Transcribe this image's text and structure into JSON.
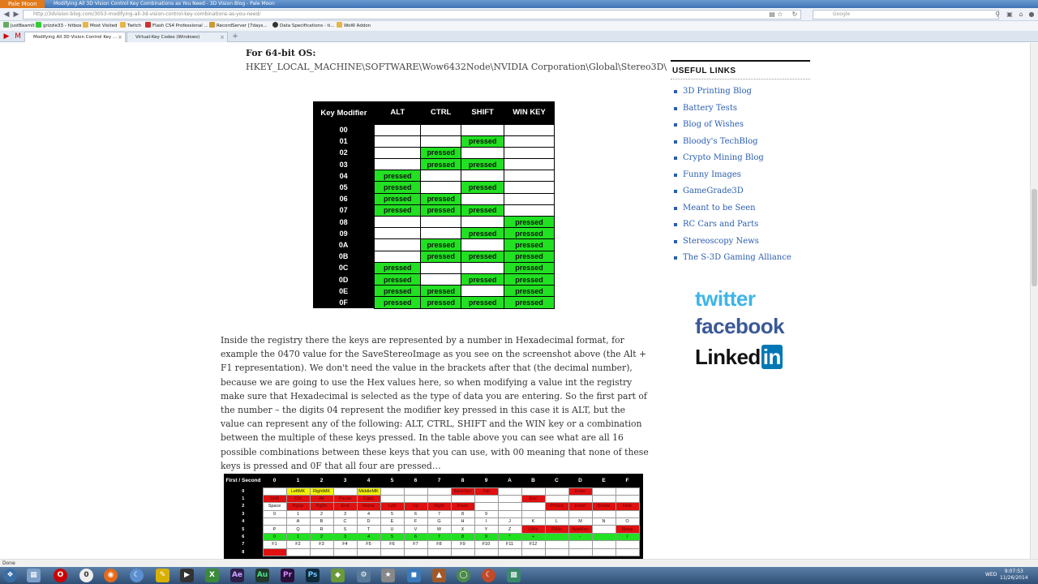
{
  "browser": {
    "app_menu": "Pale Moon",
    "window_title": "Modifying All 3D Vision Control Key Combinations as You Need - 3D Vision Blog - Pale Moon",
    "url": "http://3dvision-blog.com/3053-modifying-all-3d-vision-control-key-combinations-as-you-need/",
    "search_placeholder": "Google",
    "bookmarks": [
      "JustBeamIt",
      "grizzle33 - hitbox",
      "Most Visited",
      "Twitch",
      "Flash CS4 Professional ...",
      "RecordServer [7days...",
      "Data Specifications - ti...",
      "WoW Addon"
    ],
    "tabs": [
      {
        "label": "Modifying All 3D Vision Control Key ...",
        "active": true
      },
      {
        "label": "Virtual-Key Codes (Windows)",
        "active": false
      }
    ],
    "status": "Done"
  },
  "article": {
    "os_label": "For 64-bit OS:",
    "reg_path": "HKEY_LOCAL_MACHINE\\SOFTWARE\\Wow6432Node\\NVIDIA Corporation\\Global\\Stereo3D\\",
    "explanation": "Inside the registry there the keys are represented by a number in Hexadecimal format, for example the 0470 value for the SaveStereoImage as you see on the screenshot above (the Alt + F1 representation). We don't need the value in the brackets after that (the decimal number), because we are going to use the Hex values here, so when modifying a value int the registry make sure that Hexadecimal is selected as the type of data you are entering. So the first part of the number – the digits 04 represent the modifier key pressed in this case it is ALT, but the value can represent any of the following: ALT, CTRL, SHIFT and the WIN key or a combination between the multiple of these keys pressed. In the table above you can see what are all 16 possible combinations between these keys that you can use, with 00 meaning that none of these keys is pressed and 0F that all four are pressed…"
  },
  "modifier_table": {
    "headers": [
      "Key Modifier",
      "ALT",
      "CTRL",
      "SHIFT",
      "WIN KEY"
    ],
    "pressed_label": "pressed",
    "rows": [
      {
        "code": "00",
        "cells": [
          false,
          false,
          false,
          false
        ]
      },
      {
        "code": "01",
        "cells": [
          false,
          false,
          true,
          false
        ]
      },
      {
        "code": "02",
        "cells": [
          false,
          true,
          false,
          false
        ]
      },
      {
        "code": "03",
        "cells": [
          false,
          true,
          true,
          false
        ]
      },
      {
        "code": "04",
        "cells": [
          true,
          false,
          false,
          false
        ]
      },
      {
        "code": "05",
        "cells": [
          true,
          false,
          true,
          false
        ]
      },
      {
        "code": "06",
        "cells": [
          true,
          true,
          false,
          false
        ]
      },
      {
        "code": "07",
        "cells": [
          true,
          true,
          true,
          false
        ]
      },
      {
        "code": "08",
        "cells": [
          false,
          false,
          false,
          true
        ]
      },
      {
        "code": "09",
        "cells": [
          false,
          false,
          true,
          true
        ]
      },
      {
        "code": "0A",
        "cells": [
          false,
          true,
          false,
          true
        ]
      },
      {
        "code": "0B",
        "cells": [
          false,
          true,
          true,
          true
        ]
      },
      {
        "code": "0C",
        "cells": [
          true,
          false,
          false,
          true
        ]
      },
      {
        "code": "0D",
        "cells": [
          true,
          false,
          true,
          true
        ]
      },
      {
        "code": "0E",
        "cells": [
          true,
          true,
          false,
          true
        ]
      },
      {
        "code": "0F",
        "cells": [
          true,
          true,
          true,
          true
        ]
      }
    ]
  },
  "key_table": {
    "headers": [
      "First / Second",
      "0",
      "1",
      "2",
      "3",
      "4",
      "5",
      "6",
      "7",
      "8",
      "9",
      "A",
      "B",
      "C",
      "D",
      "E",
      "F"
    ],
    "rows": [
      {
        "label": "0",
        "cells": [
          [
            "",
            ""
          ],
          [
            "LeftMK",
            "yellow"
          ],
          [
            "RightMK",
            "yellow"
          ],
          [
            "",
            ""
          ],
          [
            "MiddleMK",
            "yellow"
          ],
          [
            "",
            ""
          ],
          [
            "",
            ""
          ],
          [
            "",
            ""
          ],
          [
            "BackSpc",
            "red"
          ],
          [
            "Tab",
            "red"
          ],
          [
            "",
            ""
          ],
          [
            "",
            ""
          ],
          [
            "",
            ""
          ],
          [
            "Enter",
            "red"
          ],
          [
            "",
            ""
          ],
          [
            "",
            ""
          ]
        ]
      },
      {
        "label": "1",
        "cells": [
          [
            "Shift",
            "red"
          ],
          [
            "Ctrl",
            "red"
          ],
          [
            "Alt",
            "red"
          ],
          [
            "Pause",
            "red"
          ],
          [
            "Caps",
            "red"
          ],
          [
            "",
            ""
          ],
          [
            "",
            ""
          ],
          [
            "",
            ""
          ],
          [
            "",
            ""
          ],
          [
            "",
            ""
          ],
          [
            "",
            ""
          ],
          [
            "Esc",
            "red"
          ],
          [
            "",
            ""
          ],
          [
            "",
            ""
          ],
          [
            "",
            ""
          ],
          [
            "",
            ""
          ]
        ]
      },
      {
        "label": "2",
        "cells": [
          [
            "Space",
            "white"
          ],
          [
            "PgUp",
            "red"
          ],
          [
            "PgDn",
            "red"
          ],
          [
            "End",
            "red"
          ],
          [
            "Home",
            "red"
          ],
          [
            "Left",
            "red"
          ],
          [
            "Up",
            "red"
          ],
          [
            "Right",
            "red"
          ],
          [
            "Down",
            "red"
          ],
          [
            "",
            ""
          ],
          [
            "",
            ""
          ],
          [
            "",
            ""
          ],
          [
            "PrtScn",
            "red"
          ],
          [
            "Insert",
            "red"
          ],
          [
            "Delete",
            "red"
          ],
          [
            "Help",
            "red"
          ]
        ]
      },
      {
        "label": "3",
        "cells": [
          [
            "0",
            ""
          ],
          [
            "1",
            ""
          ],
          [
            "2",
            ""
          ],
          [
            "3",
            ""
          ],
          [
            "4",
            ""
          ],
          [
            "5",
            ""
          ],
          [
            "6",
            ""
          ],
          [
            "7",
            ""
          ],
          [
            "8",
            ""
          ],
          [
            "9",
            ""
          ],
          [
            "",
            ""
          ],
          [
            "",
            ""
          ],
          [
            "",
            ""
          ],
          [
            "",
            ""
          ],
          [
            "",
            ""
          ],
          [
            "",
            ""
          ]
        ]
      },
      {
        "label": "4",
        "cells": [
          [
            "",
            ""
          ],
          [
            "A",
            ""
          ],
          [
            "B",
            ""
          ],
          [
            "C",
            ""
          ],
          [
            "D",
            ""
          ],
          [
            "E",
            ""
          ],
          [
            "F",
            ""
          ],
          [
            "G",
            ""
          ],
          [
            "H",
            ""
          ],
          [
            "I",
            ""
          ],
          [
            "J",
            ""
          ],
          [
            "K",
            ""
          ],
          [
            "L",
            ""
          ],
          [
            "M",
            ""
          ],
          [
            "N",
            ""
          ],
          [
            "O",
            ""
          ]
        ]
      },
      {
        "label": "5",
        "cells": [
          [
            "P",
            ""
          ],
          [
            "Q",
            ""
          ],
          [
            "R",
            ""
          ],
          [
            "S",
            ""
          ],
          [
            "T",
            ""
          ],
          [
            "U",
            ""
          ],
          [
            "V",
            ""
          ],
          [
            "W",
            ""
          ],
          [
            "X",
            ""
          ],
          [
            "Y",
            ""
          ],
          [
            "Z",
            ""
          ],
          [
            "LWin",
            "red"
          ],
          [
            "RWin",
            "red"
          ],
          [
            "AppMnu",
            "red"
          ],
          [
            "",
            ""
          ],
          [
            "Sleep",
            "red"
          ]
        ]
      },
      {
        "label": "6",
        "cells": [
          [
            "0",
            "green"
          ],
          [
            "1",
            "green"
          ],
          [
            "2",
            "green"
          ],
          [
            "3",
            "green"
          ],
          [
            "4",
            "green"
          ],
          [
            "5",
            "green"
          ],
          [
            "6",
            "green"
          ],
          [
            "7",
            "green"
          ],
          [
            "8",
            "green"
          ],
          [
            "9",
            "green"
          ],
          [
            "*",
            "green"
          ],
          [
            "+",
            "green"
          ],
          [
            "",
            "green"
          ],
          [
            "-",
            "green"
          ],
          [
            "",
            "green"
          ],
          [
            "/",
            "green"
          ]
        ]
      },
      {
        "label": "7",
        "cells": [
          [
            "F1",
            ""
          ],
          [
            "F2",
            ""
          ],
          [
            "F3",
            ""
          ],
          [
            "F4",
            ""
          ],
          [
            "F5",
            ""
          ],
          [
            "F6",
            ""
          ],
          [
            "F7",
            ""
          ],
          [
            "F8",
            ""
          ],
          [
            "F9",
            ""
          ],
          [
            "F10",
            ""
          ],
          [
            "F11",
            ""
          ],
          [
            "F12",
            ""
          ],
          [
            "",
            ""
          ],
          [
            "",
            ""
          ],
          [
            "",
            ""
          ],
          [
            "",
            ""
          ]
        ]
      },
      {
        "label": "8",
        "cells": [
          [
            "",
            "red"
          ],
          [
            "",
            ""
          ],
          [
            "",
            ""
          ],
          [
            "",
            ""
          ],
          [
            "",
            ""
          ],
          [
            "",
            ""
          ],
          [
            "",
            ""
          ],
          [
            "",
            ""
          ],
          [
            "",
            ""
          ],
          [
            "",
            ""
          ],
          [
            "",
            ""
          ],
          [
            "",
            ""
          ],
          [
            "",
            ""
          ],
          [
            "",
            ""
          ],
          [
            "",
            ""
          ],
          [
            "",
            ""
          ]
        ]
      }
    ]
  },
  "sidebar": {
    "title": "USEFUL LINKS",
    "links": [
      "3D Printing Blog",
      "Battery Tests",
      "Blog of Wishes",
      "Bloody's TechBlog",
      "Crypto Mining Blog",
      "Funny Images",
      "GameGrade3D",
      "Meant to be Seen",
      "RC Cars and Parts",
      "Stereoscopy News",
      "The S-3D Gaming Alliance"
    ],
    "twitter": "twitter",
    "facebook": "facebook",
    "linkedin_a": "Linked",
    "linkedin_b": "in"
  },
  "taskbar": {
    "time": "9:07:53",
    "day": "WED",
    "date": "11/26/2014"
  }
}
